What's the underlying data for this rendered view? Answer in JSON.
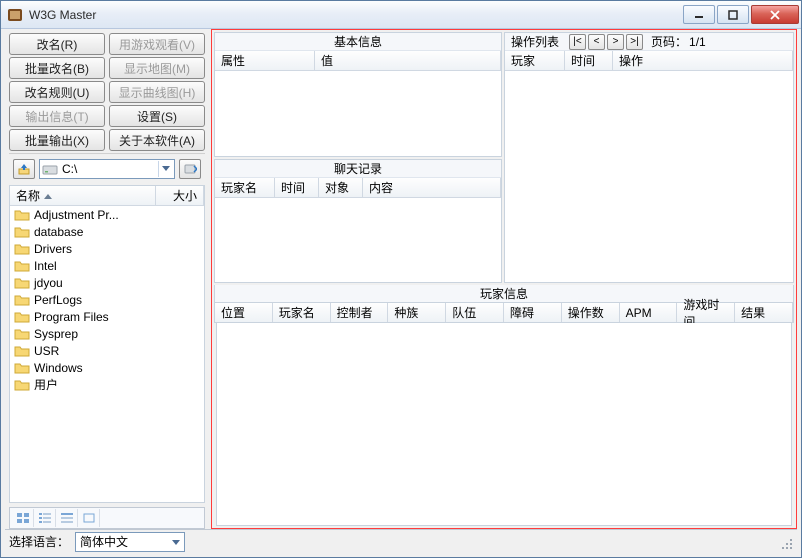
{
  "window": {
    "title": "W3G Master"
  },
  "toolbar": {
    "rename": "改名(R)",
    "watch_game": "用游戏观看(V)",
    "batch_rename": "批量改名(B)",
    "show_map": "显示地图(M)",
    "rename_rule": "改名规则(U)",
    "show_curve": "显示曲线图(H)",
    "output_info": "输出信息(T)",
    "settings": "设置(S)",
    "batch_output": "批量输出(X)",
    "about": "关于本软件(A)"
  },
  "drive": {
    "label": "C:\\"
  },
  "filelist": {
    "cols": {
      "name": "名称",
      "size": "大小"
    },
    "items": [
      "Adjustment Pr...",
      "database",
      "Drivers",
      "Intel",
      "jdyou",
      "PerfLogs",
      "Program Files",
      "Sysprep",
      "USR",
      "Windows",
      "用户"
    ]
  },
  "basic": {
    "title": "基本信息",
    "cols": {
      "attr": "属性",
      "value": "值"
    }
  },
  "chat": {
    "title": "聊天记录",
    "cols": {
      "player": "玩家名",
      "time": "时间",
      "target": "对象",
      "content": "内容"
    }
  },
  "oplist": {
    "title": "操作列表",
    "cols": {
      "player": "玩家",
      "time": "时间",
      "op": "操作"
    },
    "page_label": "页码：",
    "page": "1/1"
  },
  "players": {
    "title": "玩家信息",
    "cols": [
      "位置",
      "玩家名",
      "控制者",
      "种族",
      "队伍",
      "障碍",
      "操作数",
      "APM",
      "游戏时间",
      "结果"
    ]
  },
  "status": {
    "lang_label": "选择语言：",
    "lang_value": "简体中文"
  }
}
